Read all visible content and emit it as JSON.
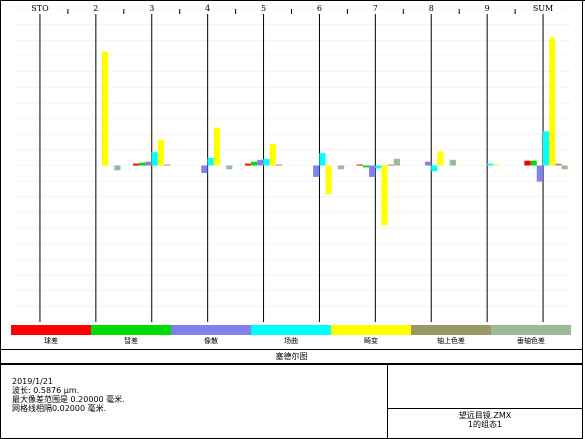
{
  "chart_data": {
    "type": "bar",
    "categories": [
      "STO",
      "2",
      "3",
      "4",
      "5",
      "6",
      "7",
      "8",
      "9",
      "SUM"
    ],
    "series": [
      {
        "name": "球差",
        "color": "#ff0000",
        "values": [
          0,
          0,
          0.2,
          0,
          0.2,
          0,
          0.1,
          0,
          0,
          0.5
        ]
      },
      {
        "name": "彗差",
        "color": "#00dd00",
        "values": [
          0,
          0,
          0.3,
          0,
          0.4,
          0,
          -0.2,
          0,
          0,
          0.5
        ]
      },
      {
        "name": "像散",
        "color": "#8080ee",
        "values": [
          0,
          0,
          0.4,
          -0.8,
          0.6,
          -1.2,
          -1.2,
          0.4,
          0,
          -1.7
        ]
      },
      {
        "name": "场曲",
        "color": "#00ffff",
        "values": [
          0,
          0,
          1.4,
          0.8,
          0.7,
          1.3,
          -0.3,
          -0.6,
          0.2,
          3.6
        ]
      },
      {
        "name": "畸变",
        "color": "#ffff00",
        "values": [
          0,
          12,
          2.7,
          4.0,
          2.3,
          -3.0,
          -6.3,
          1.5,
          0.1,
          13.5
        ]
      },
      {
        "name": "轴上色差",
        "color": "#999966",
        "values": [
          0,
          0,
          0.1,
          0,
          0.1,
          0,
          0.1,
          0,
          0,
          0.2
        ]
      },
      {
        "name": "垂轴色差",
        "color": "#99bb99",
        "values": [
          0,
          -0.5,
          0,
          -0.4,
          0,
          -0.4,
          0.7,
          0.6,
          0,
          -0.4
        ]
      }
    ],
    "ylim": [
      -16.5,
      16.5
    ],
    "grid": true,
    "legend": "bottom"
  },
  "caption": "塞德尔图",
  "info": {
    "lines": [
      "2019/1/21",
      "波长: 0.5876 µm.",
      "最大像差范围是 0.20000 毫米.",
      "网格线相隔0.02000 毫米."
    ],
    "file": "望远目镜.ZMX",
    "config": "1的组态1"
  }
}
